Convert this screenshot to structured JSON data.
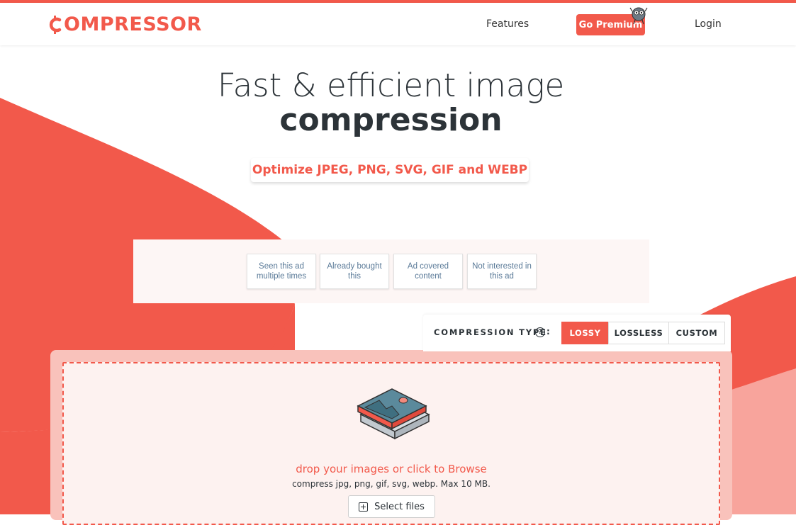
{
  "brand": {
    "name": "COMPRESSOR",
    "name_rest": "OMPRESSOR",
    "accent_color": "#f2594b"
  },
  "nav": {
    "features_label": "Features",
    "premium_label": "Go Premium",
    "login_label": "Login"
  },
  "hero": {
    "title_line1": "Fast & efficient image",
    "title_line2": "compression",
    "badge": "Optimize JPEG, PNG, SVG, GIF and WEBP"
  },
  "ad_feedback": {
    "options": [
      "Seen this ad multiple times",
      "Already bought this",
      "Ad covered content",
      "Not interested in this ad"
    ]
  },
  "compression": {
    "label": "COMPRESSION TYPE",
    "help_icon": "?",
    "colon": ":",
    "options": [
      "LOSSY",
      "LOSSLESS",
      "CUSTOM"
    ],
    "selected": "LOSSY"
  },
  "dropzone": {
    "title": "drop your images or click to Browse",
    "subtitle": "compress jpg, png, gif, svg, webp. Max 10 MB.",
    "button_label": "Select files",
    "icons": [
      "image-stack-icon",
      "plus-square-icon"
    ]
  }
}
